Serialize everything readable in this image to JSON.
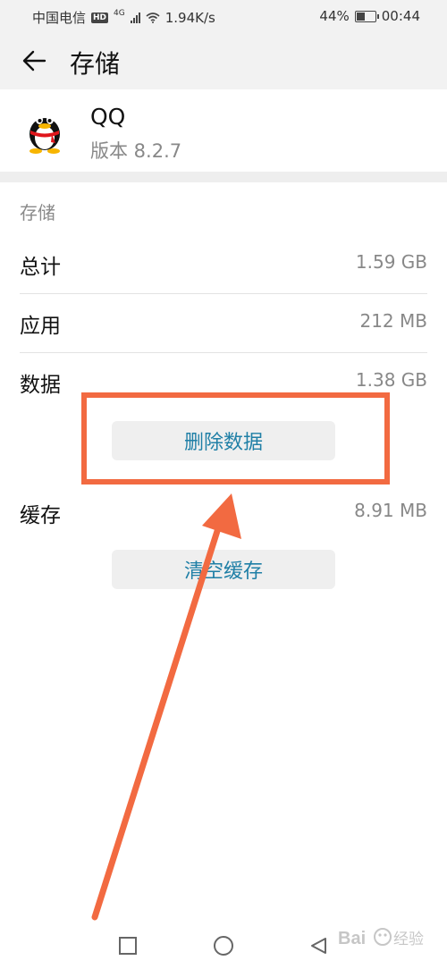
{
  "status_bar": {
    "carrier": "中国电信",
    "hd": "HD",
    "network": "4G",
    "speed": "1.94K/s",
    "battery": "44%",
    "battery_level": 0.44,
    "time": "00:44"
  },
  "app_bar": {
    "title": "存储",
    "back_icon": "arrow-left-icon"
  },
  "app_info": {
    "name": "QQ",
    "version": "版本 8.2.7",
    "icon": "qq-penguin-icon"
  },
  "storage": {
    "section_title": "存储",
    "rows": [
      {
        "label": "总计",
        "value": "1.59 GB"
      },
      {
        "label": "应用",
        "value": "212 MB"
      },
      {
        "label": "数据",
        "value": "1.38 GB"
      },
      {
        "label": "缓存",
        "value": "8.91 MB"
      }
    ],
    "delete_data_button": "删除数据",
    "clear_cache_button": "清空缓存"
  },
  "annotation": {
    "color": "#f26a41"
  },
  "nav_bar": {
    "recents_icon": "square-icon",
    "home_icon": "circle-icon",
    "back_icon": "triangle-back-icon"
  },
  "colors": {
    "accent": "#1f7fa6",
    "annotation": "#f26a41",
    "header_bg": "#f2f2f2"
  }
}
